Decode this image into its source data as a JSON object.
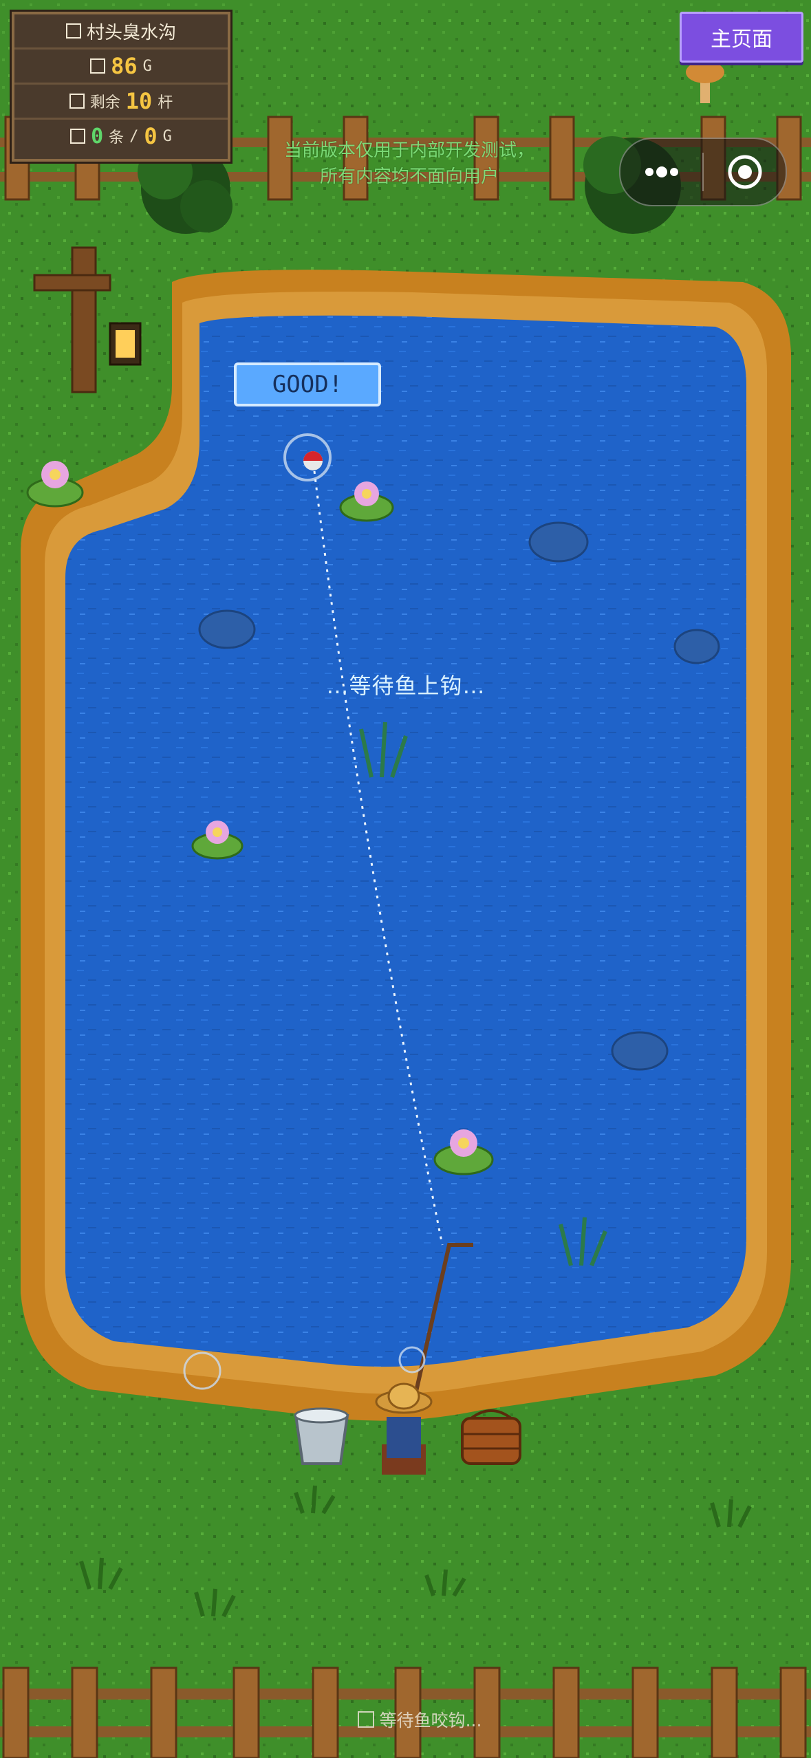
{
  "hud": {
    "location": "村头臭水沟",
    "gold_value": "86",
    "gold_unit": "G",
    "remaining_label": "剩余",
    "remaining_value": "10",
    "remaining_unit": "杆",
    "catch_count": "0",
    "catch_unit": "条",
    "separator": "/",
    "catch_gold": "0",
    "catch_gold_unit": "G"
  },
  "home_button": {
    "label": "主页面"
  },
  "notice": {
    "line1": "当前版本仅用于内部开发测试，",
    "line2": "所有内容均不面向用户"
  },
  "feedback": {
    "label": "GOOD!"
  },
  "status": {
    "waiting_text": "…等待鱼上钩…"
  },
  "footer": {
    "text": "等待鱼咬钩..."
  },
  "colors": {
    "water": "#1f63c9",
    "grass": "#3f8f2a",
    "shore": "#c8811f",
    "home_button": "#7c4ee0"
  }
}
